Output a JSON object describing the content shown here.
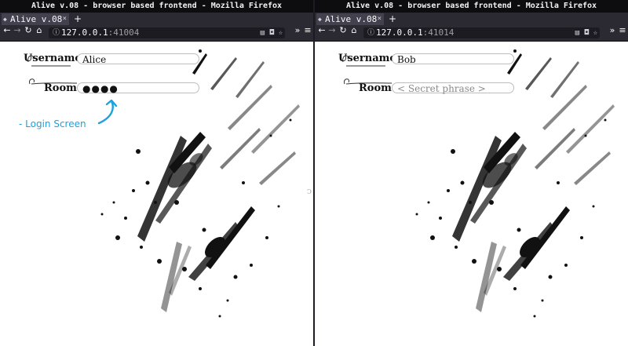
{
  "windows": [
    {
      "title": "Alive v.08 - browser based frontend - Mozilla Firefox",
      "tab": {
        "label": "Alive v.08",
        "close": "×"
      },
      "new_tab": "+",
      "url": {
        "host": "127.0.0.1",
        "port": ":41004"
      },
      "form": {
        "username_label": "Username:",
        "username_value": "Alice",
        "room_label": "Room:",
        "room_value": "●●●●",
        "room_placeholder": ""
      },
      "annotation": "- Login Screen"
    },
    {
      "title": "Alive v.08 - browser based frontend - Mozilla Firefox",
      "tab": {
        "label": "Alive v.08",
        "close": "×"
      },
      "new_tab": "+",
      "url": {
        "host": "127.0.0.1",
        "port": ":41014"
      },
      "form": {
        "username_label": "Username:",
        "username_value": "Bob",
        "room_label": "Room:",
        "room_value": "",
        "room_placeholder": "< Secret phrase >"
      }
    }
  ],
  "icons": {
    "back": "back-arrow-icon",
    "forward": "forward-arrow-icon",
    "reload": "reload-icon",
    "home": "home-icon",
    "info": "site-info-icon",
    "reader": "reader-view-icon",
    "pocket": "pocket-icon",
    "bookmark": "bookmark-star-icon",
    "overflow": "overflow-chevrons-icon",
    "menu": "hamburger-menu-icon"
  },
  "colors": {
    "chrome_dark": "#2b2a33",
    "titlebar": "#0d0d10",
    "annotation_blue": "#1ba2e0",
    "ink": "#111111"
  }
}
